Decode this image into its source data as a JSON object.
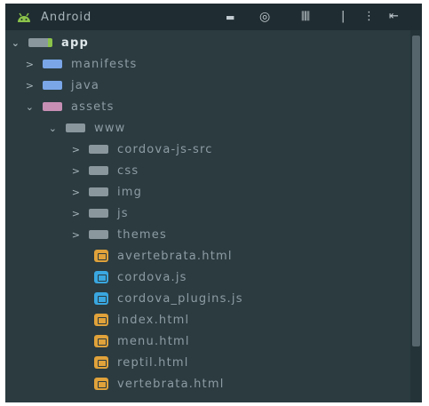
{
  "header": {
    "title": "Android",
    "icons": [
      "android-icon",
      "dropdown-caret-icon",
      "target-icon",
      "collapse-all-icon",
      "divider-icon",
      "more-options-icon",
      "hide-panel-icon"
    ]
  },
  "tree": [
    {
      "label": "app",
      "type": "module",
      "expanded": true,
      "depth": 0,
      "icon": "module-folder-icon"
    },
    {
      "label": "manifests",
      "type": "folder",
      "expanded": false,
      "depth": 1,
      "icon": "folder-icon"
    },
    {
      "label": "java",
      "type": "folder",
      "expanded": false,
      "depth": 1,
      "icon": "folder-icon"
    },
    {
      "label": "assets",
      "type": "folder",
      "expanded": true,
      "depth": 1,
      "icon": "assets-folder-icon"
    },
    {
      "label": "www",
      "type": "folder",
      "expanded": true,
      "depth": 2,
      "icon": "folder-icon"
    },
    {
      "label": "cordova-js-src",
      "type": "folder",
      "expanded": false,
      "depth": 3,
      "icon": "folder-icon"
    },
    {
      "label": "css",
      "type": "folder",
      "expanded": false,
      "depth": 3,
      "icon": "folder-icon"
    },
    {
      "label": "img",
      "type": "folder",
      "expanded": false,
      "depth": 3,
      "icon": "folder-icon"
    },
    {
      "label": "js",
      "type": "folder",
      "expanded": false,
      "depth": 3,
      "icon": "folder-icon"
    },
    {
      "label": "themes",
      "type": "folder",
      "expanded": false,
      "depth": 3,
      "icon": "folder-icon"
    },
    {
      "label": "avertebrata.html",
      "type": "html",
      "depth": 3,
      "icon": "html-file-icon"
    },
    {
      "label": "cordova.js",
      "type": "js",
      "depth": 3,
      "icon": "js-file-icon"
    },
    {
      "label": "cordova_plugins.js",
      "type": "js",
      "depth": 3,
      "icon": "js-file-icon"
    },
    {
      "label": "index.html",
      "type": "html",
      "depth": 3,
      "icon": "html-file-icon"
    },
    {
      "label": "menu.html",
      "type": "html",
      "depth": 3,
      "icon": "html-file-icon"
    },
    {
      "label": "reptil.html",
      "type": "html",
      "depth": 3,
      "icon": "html-file-icon"
    },
    {
      "label": "vertebrata.html",
      "type": "html",
      "depth": 3,
      "icon": "html-file-icon"
    }
  ],
  "colors": {
    "panel_bg": "#2b3b40",
    "header_bg": "#1f2c31",
    "folder_blue": "#7aa6e8",
    "folder_gray": "#8a979d",
    "assets_pink": "#c78fb4",
    "html_orange": "#e0a23a",
    "js_blue": "#3aa7e0",
    "android_green": "#8bc34a"
  }
}
